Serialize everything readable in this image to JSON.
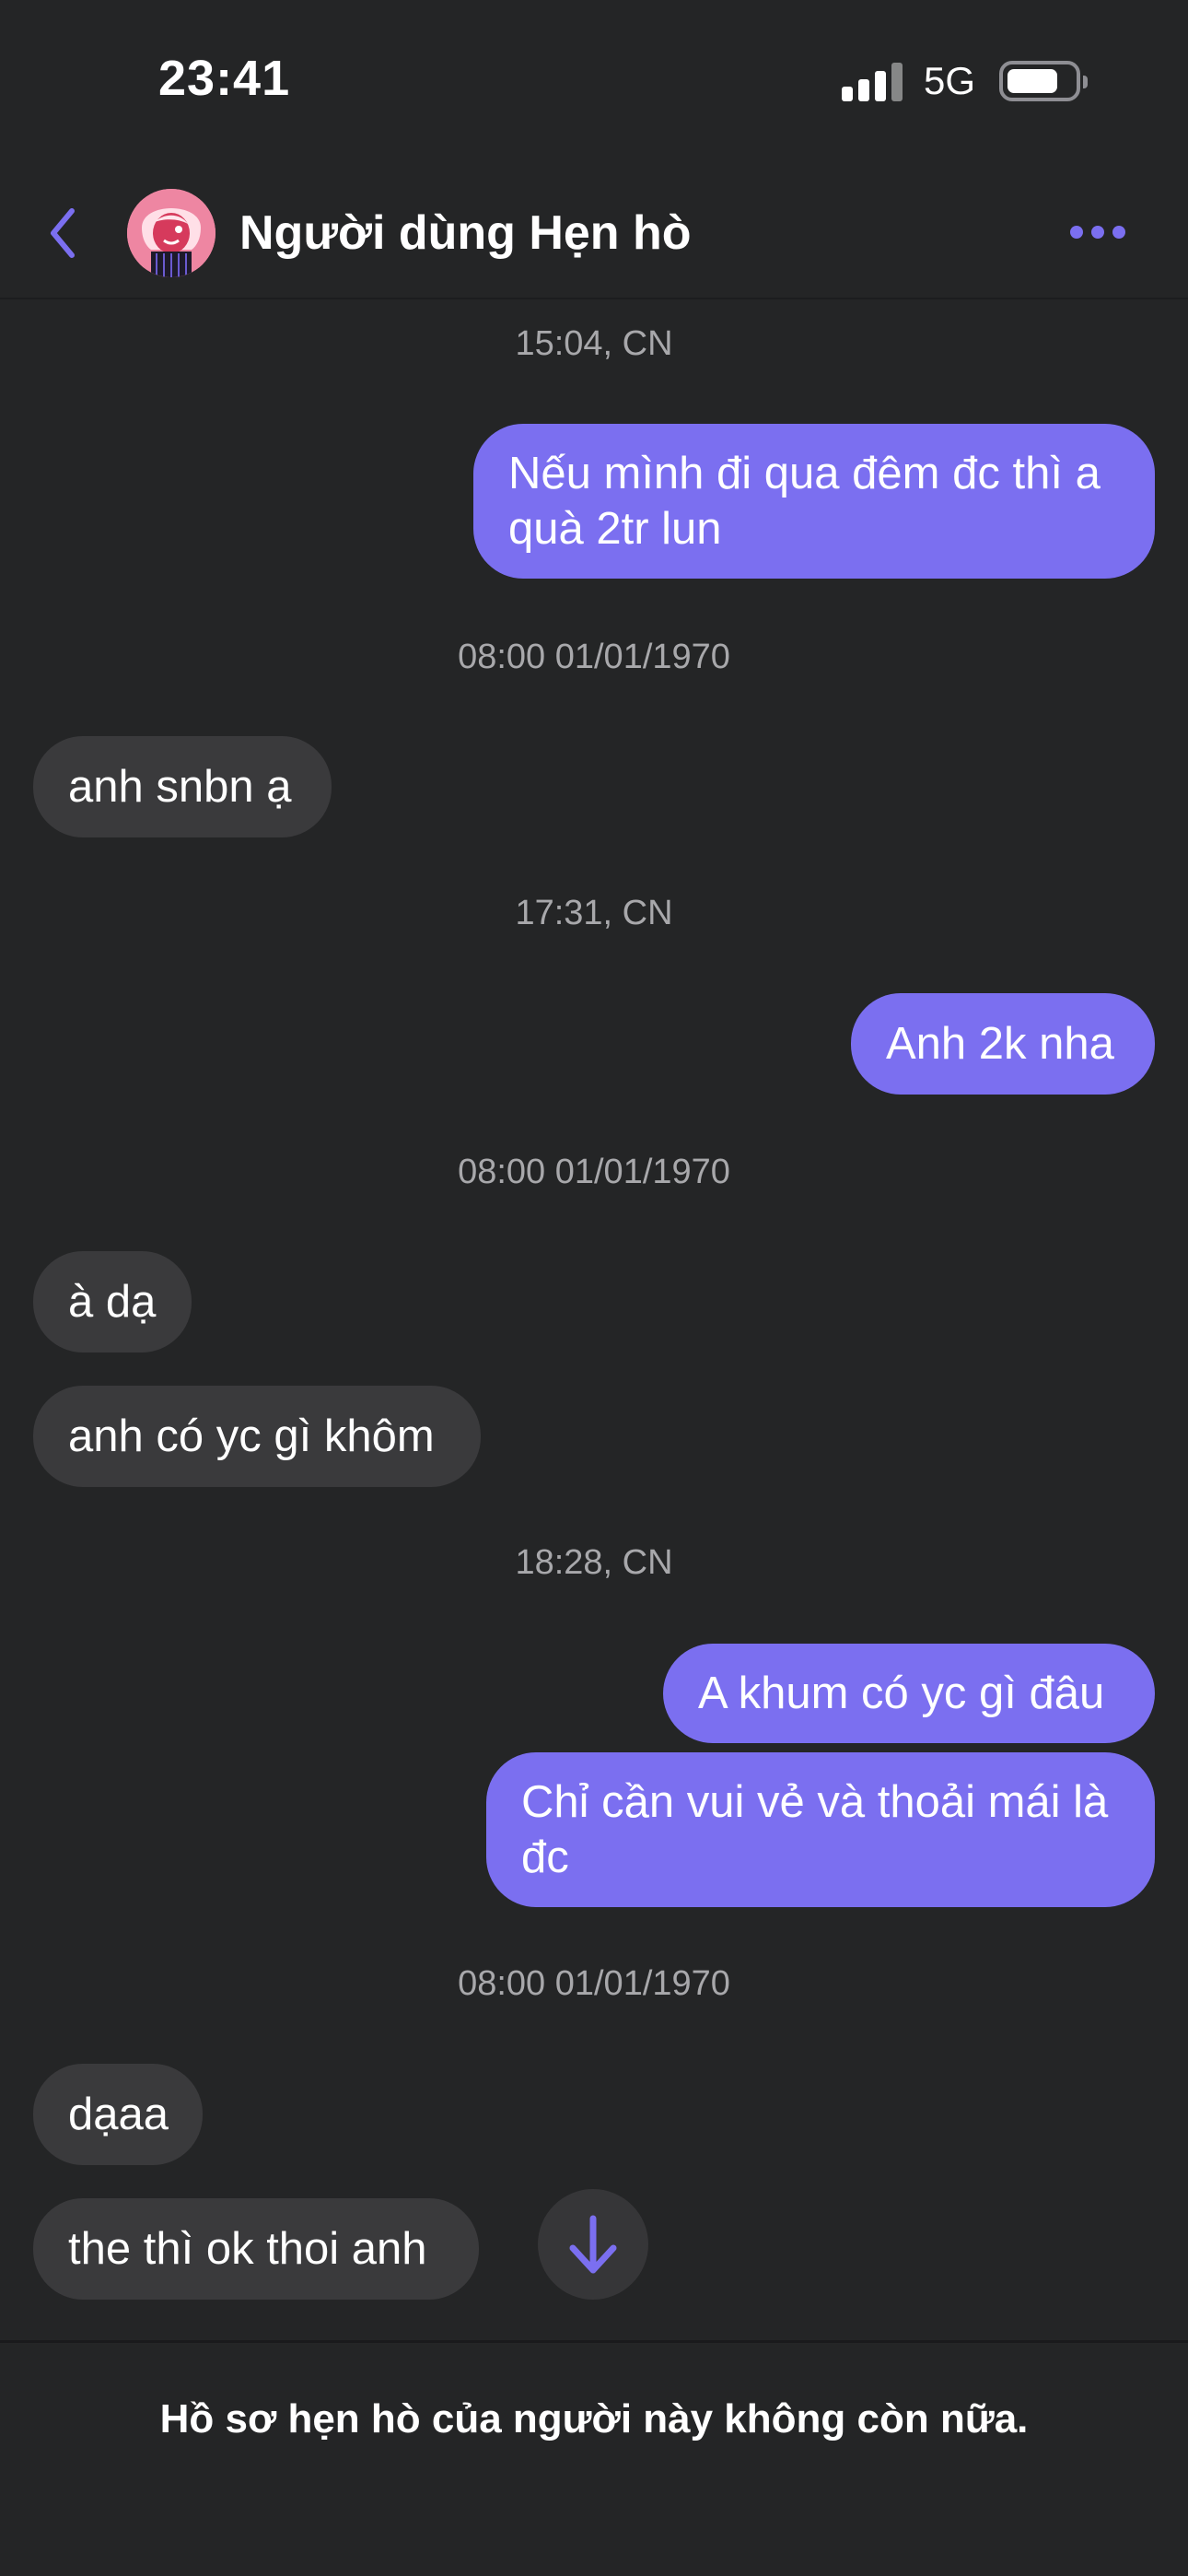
{
  "status_bar": {
    "time": "23:41",
    "network": "5G",
    "icons": [
      "signal-icon",
      "battery-icon"
    ]
  },
  "header": {
    "title": "Người dùng Hẹn hò",
    "icons": [
      "back-chevron-icon",
      "avatar",
      "more-dots-icon"
    ],
    "accent_color": "#7b6ff0"
  },
  "conversation": {
    "timestamps": [
      "15:04, CN",
      "08:00 01/01/1970",
      "17:31, CN",
      "08:00 01/01/1970",
      "18:28, CN",
      "08:00 01/01/1970"
    ],
    "messages": [
      {
        "side": "outgoing",
        "text": "Nếu mình đi qua đêm đc thì a quà 2tr lun"
      },
      {
        "side": "incoming",
        "text": "anh snbn ạ"
      },
      {
        "side": "outgoing",
        "text": "Anh 2k nha"
      },
      {
        "side": "incoming",
        "text": "à dạ"
      },
      {
        "side": "incoming",
        "text": "anh có yc gì khôm"
      },
      {
        "side": "outgoing",
        "text": "A khum có yc gì đâu"
      },
      {
        "side": "outgoing",
        "text": "Chỉ cần vui vẻ và thoải mái là đc"
      },
      {
        "side": "incoming",
        "text": "dạaa"
      },
      {
        "side": "incoming",
        "text": "the thì ok thoi anh"
      }
    ],
    "outgoing_color": "#7b6ff0",
    "incoming_color": "#3a3a3c"
  },
  "scroll_button": {
    "icon": "arrow-down-icon"
  },
  "footer": {
    "notice": "Hồ sơ hẹn hò của người này không còn nữa."
  }
}
